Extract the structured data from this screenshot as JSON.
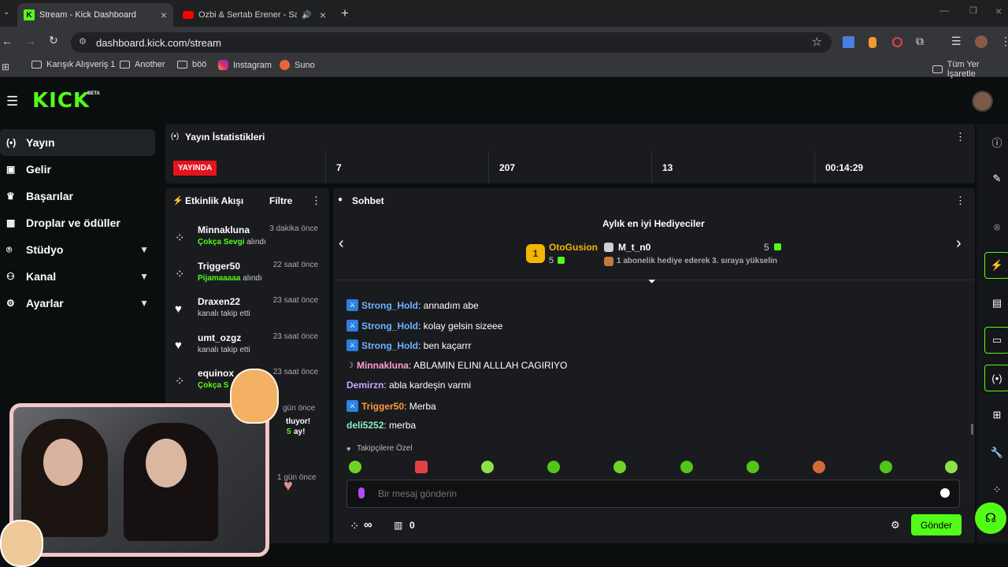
{
  "browser": {
    "tabs": [
      {
        "title": "Stream - Kick Dashboard",
        "active": true
      },
      {
        "title": "Ozbi & Sertab Erener - Sav",
        "active": false
      }
    ],
    "new_tab": "+",
    "url": "dashboard.kick.com/stream",
    "bookmarks": [
      "Karışık Alışveriş 1",
      "Another",
      "böö",
      "Instagram",
      "Suno"
    ],
    "all_bookmarks": "Tüm Yer İşaretle"
  },
  "app": {
    "logo": "KICK",
    "logo_tag": "BETA",
    "nav": [
      {
        "label": "Yayın",
        "icon": "broadcast-icon"
      },
      {
        "label": "Gelir",
        "icon": "revenue-icon"
      },
      {
        "label": "Başarılar",
        "icon": "trophy-icon"
      },
      {
        "label": "Droplar ve ödüller",
        "icon": "gift-icon"
      },
      {
        "label": "Stüdyo",
        "icon": "studio-icon"
      },
      {
        "label": "Kanal",
        "icon": "channel-icon"
      },
      {
        "label": "Ayarlar",
        "icon": "settings-icon"
      }
    ]
  },
  "stats": {
    "title": "Yayın İstatistikleri",
    "live_badge": "YAYINDA",
    "values": [
      "7",
      "207",
      "13",
      "00:14:29"
    ]
  },
  "activity": {
    "title": "Etkinlik Akışı",
    "filter": "Filtre",
    "events": [
      {
        "name": "Minnakluna",
        "time": "3 dakika önce",
        "hl": "Çokça Sevgi",
        "rest": "alındı"
      },
      {
        "name": "Trigger50",
        "time": "22 saat önce",
        "hl": "Pijamaaaaa",
        "rest": "alındı"
      },
      {
        "name": "Draxen22",
        "time": "23 saat önce",
        "hl": "",
        "rest": "kanalı takip etti"
      },
      {
        "name": "umt_ozgz",
        "time": "23 saat önce",
        "hl": "",
        "rest": "kanalı takip etti"
      },
      {
        "name": "equinox",
        "time": "23 saat önce",
        "hl": "Çokça S",
        "rest": ""
      }
    ],
    "partial": {
      "time1": "gün önce",
      "line1": "tluyor!",
      "line2": "5",
      "line3": "ay!",
      "time2": "1 gün önce"
    }
  },
  "chat": {
    "title": "Sohbet",
    "gifters_title": "Aylık en iyi Hediyeciler",
    "top1": {
      "rank": "1",
      "name": "OtoGusion",
      "count": "5"
    },
    "top2": {
      "name": "M_t_n0",
      "count": "5"
    },
    "promo": "1 abonelik hediye ederek 3. sıraya yükselin",
    "messages": [
      {
        "user": "Strong_Hold",
        "text": ": annadım abe",
        "color": "#6fb3ff"
      },
      {
        "user": "Strong_Hold",
        "text": ": kolay gelsin sizeee",
        "color": "#6fb3ff"
      },
      {
        "user": "Strong_Hold",
        "text": ": ben kaçarrr",
        "color": "#6fb3ff"
      },
      {
        "user": "Minnakluna",
        "text": ": ABLAMIN ELINI ALLLAH CAGIRIYO",
        "color": "#ff9ed0"
      },
      {
        "user": "Demirzn",
        "text": ": abla kardeşin varmi",
        "color": "#c9a6ff"
      },
      {
        "user": "Trigger50",
        "text": ": Merba",
        "color": "#ff9a3c"
      },
      {
        "user": "deli5252",
        "text": ": merba",
        "color": "#8ef0c8"
      }
    ],
    "followers_only": "Takipçilere Özel",
    "placeholder": "Bir mesaj gönderin",
    "points": "∞",
    "count": "0",
    "send": "Gönder"
  },
  "colors": {
    "accent": "#53fc18",
    "live": "#e5131d"
  }
}
